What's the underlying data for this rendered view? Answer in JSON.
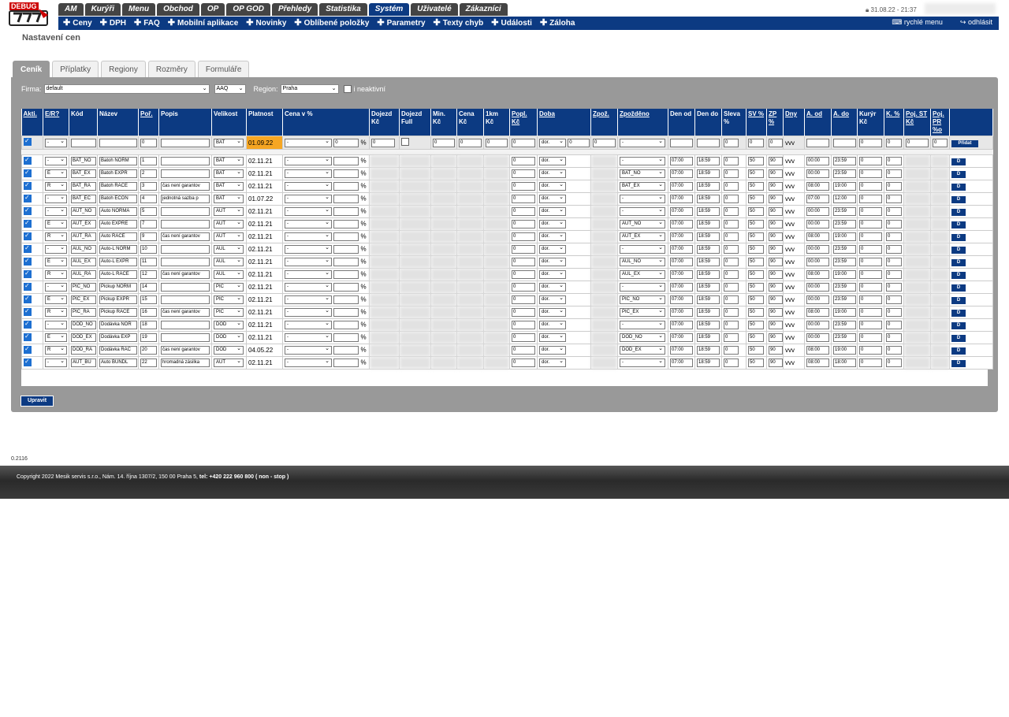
{
  "header": {
    "debug_label": "DEBUG",
    "tabs": [
      "AM",
      "Kurýři",
      "Menu",
      "Obchod",
      "OP",
      "OP GOD",
      "Přehledy",
      "Statistika",
      "Systém",
      "Uživatelé",
      "Zákazníci"
    ],
    "active_tab": "Systém",
    "submenu": [
      "Ceny",
      "DPH",
      "FAQ",
      "Mobilní aplikace",
      "Novinky",
      "Oblíbené položky",
      "Parametry",
      "Texty chyb",
      "Události",
      "Záloha"
    ],
    "quick_menu": "rychlé menu",
    "logout": "odhlásit",
    "clock": "31.08.22 - 21:37"
  },
  "page_title": "Nastavení cen",
  "page_tabs": [
    "Ceník",
    "Příplatky",
    "Regiony",
    "Rozměry",
    "Formuláře"
  ],
  "filters": {
    "firma_label": "Firma:",
    "firma_value": "default",
    "aaq_value": "AAQ",
    "region_label": "Region:",
    "region_value": "Praha",
    "inactive_label": "i neaktivní"
  },
  "table": {
    "headers": [
      "Akti.",
      "E/R?",
      "Kód",
      "Název",
      "Poř.",
      "Popis",
      "Velikost",
      "Platnost",
      "Cena v %",
      "Dojezd Kč",
      "Dojezd Full",
      "Min. Kč",
      "Cena Kč",
      "1km Kč",
      "Popl. Kč",
      "Doba",
      "Zpož.",
      "Zpožděno",
      "Den od",
      "Den do",
      "Sleva %",
      "SV %",
      "ZP %",
      "Dny",
      "A. od",
      "A. do",
      "Kurýr Kč",
      "K. %",
      "Poj. ST Kč",
      "Poj. PR %o",
      ""
    ],
    "new_row": {
      "er": "-",
      "poradi": "0",
      "velikost": "BAT",
      "platnost": "01.09.22",
      "cena": "-",
      "cena_pct": "0",
      "pct": "%",
      "dojezd": "0",
      "min": "0",
      "cena_kc": "0",
      "km": "0",
      "popl": "0",
      "doba": "dor.",
      "doba_val": "0",
      "zpoz": "0",
      "zpozdeno": "-",
      "sleva": "0",
      "sv": "0",
      "zp": "0",
      "dny": "vvv",
      "kuryr": "0",
      "k": "0",
      "poj_st": "0",
      "poj_pr": "0",
      "button": "Přidat"
    },
    "rows": [
      {
        "er": "-",
        "kod": "BAT_NO",
        "nazev": "Batoh NORM",
        "por": "1",
        "popis": "",
        "vel": "BAT",
        "plat": "02.11.21",
        "zpozdeno": "-",
        "aod": "00:00",
        "ado": "23:59"
      },
      {
        "er": "E",
        "kod": "BAT_EX",
        "nazev": "Batoh EXPR",
        "por": "2",
        "popis": "",
        "vel": "BAT",
        "plat": "02.11.21",
        "zpozdeno": "BAT_NO",
        "aod": "00:00",
        "ado": "23:59"
      },
      {
        "er": "R",
        "kod": "BAT_RA",
        "nazev": "Batoh RACE",
        "por": "3",
        "popis": "čas není garantov",
        "vel": "BAT",
        "plat": "02.11.21",
        "zpozdeno": "BAT_EX",
        "aod": "08:00",
        "ado": "19:00"
      },
      {
        "er": "-",
        "kod": "BAT_EC",
        "nazev": "Batoh ECON",
        "por": "4",
        "popis": "jednotná sazba p",
        "vel": "BAT",
        "plat": "01.07.22",
        "zpozdeno": "-",
        "aod": "07:00",
        "ado": "12:00"
      },
      {
        "er": "-",
        "kod": "AUT_NO",
        "nazev": "Auto NORMA",
        "por": "5",
        "popis": "",
        "vel": "AUT",
        "plat": "02.11.21",
        "zpozdeno": "-",
        "aod": "00:00",
        "ado": "23:59"
      },
      {
        "er": "E",
        "kod": "AUT_EX",
        "nazev": "Auto EXPRE",
        "por": "7",
        "popis": "",
        "vel": "AUT",
        "plat": "02.11.21",
        "zpozdeno": "AUT_NO",
        "aod": "00:00",
        "ado": "23:59"
      },
      {
        "er": "R",
        "kod": "AUT_RA",
        "nazev": "Auto RACE",
        "por": "9",
        "popis": "čas není garantov",
        "vel": "AUT",
        "plat": "02.11.21",
        "zpozdeno": "AUT_EX",
        "aod": "08:00",
        "ado": "19:00"
      },
      {
        "er": "-",
        "kod": "AUL_NO",
        "nazev": "Auto-L NORM",
        "por": "10",
        "popis": "",
        "vel": "AUL",
        "plat": "02.11.21",
        "zpozdeno": "-",
        "aod": "00:00",
        "ado": "23:59"
      },
      {
        "er": "E",
        "kod": "AUL_EX",
        "nazev": "Auto-L EXPR",
        "por": "11",
        "popis": "",
        "vel": "AUL",
        "plat": "02.11.21",
        "zpozdeno": "AUL_NO",
        "aod": "00:00",
        "ado": "23:59"
      },
      {
        "er": "R",
        "kod": "AUL_RA",
        "nazev": "Auto-L RACE",
        "por": "12",
        "popis": "čas není garantov",
        "vel": "AUL",
        "plat": "02.11.21",
        "zpozdeno": "AUL_EX",
        "aod": "08:00",
        "ado": "19:00"
      },
      {
        "er": "-",
        "kod": "PIC_NO",
        "nazev": "Pickup NORM",
        "por": "14",
        "popis": "",
        "vel": "PIC",
        "plat": "02.11.21",
        "zpozdeno": "-",
        "aod": "00:00",
        "ado": "23:59"
      },
      {
        "er": "E",
        "kod": "PIC_EX",
        "nazev": "Pickup EXPR",
        "por": "15",
        "popis": "",
        "vel": "PIC",
        "plat": "02.11.21",
        "zpozdeno": "PIC_NO",
        "aod": "00:00",
        "ado": "23:59"
      },
      {
        "er": "R",
        "kod": "PIC_RA",
        "nazev": "Pickup RACE",
        "por": "16",
        "popis": "čas není garantov",
        "vel": "PIC",
        "plat": "02.11.21",
        "zpozdeno": "PIC_EX",
        "aod": "08:00",
        "ado": "19:00"
      },
      {
        "er": "-",
        "kod": "DOD_NO",
        "nazev": "Dodávka NOR",
        "por": "18",
        "popis": "",
        "vel": "DOD",
        "plat": "02.11.21",
        "zpozdeno": "-",
        "aod": "00:00",
        "ado": "23:59"
      },
      {
        "er": "E",
        "kod": "DOD_EX",
        "nazev": "Dodávka EXP",
        "por": "19",
        "popis": "",
        "vel": "DOD",
        "plat": "02.11.21",
        "zpozdeno": "DOD_NO",
        "aod": "00:00",
        "ado": "23:59"
      },
      {
        "er": "R",
        "kod": "DOD_RA",
        "nazev": "Dodávka RAC",
        "por": "20",
        "popis": "čas není garantov",
        "vel": "DOD",
        "plat": "04.05.22",
        "zpozdeno": "DOD_EX",
        "aod": "08:00",
        "ado": "19:00"
      },
      {
        "er": "-",
        "kod": "AUT_BU",
        "nazev": "Auto BUNDL",
        "por": "22",
        "popis": "hromadná zásilka",
        "vel": "AUT",
        "plat": "02.11.21",
        "zpozdeno": "-",
        "aod": "08:00",
        "ado": "18:00"
      }
    ],
    "row_common": {
      "cena": "-",
      "pct": "%",
      "popl": "0",
      "doba": "dor.",
      "den_od": "07:00",
      "den_do": "18:59",
      "sleva": "0",
      "sv": "50",
      "zp": "90",
      "dny": "vvv",
      "kuryr": "0",
      "k": "0",
      "button": "D"
    }
  },
  "save_button": "Upravit",
  "version": "0.2116",
  "footer": {
    "text": "Copyright 2022 Mesik servis s.r.o., Nám. 14. října 1307/2, 150 00 Praha 5,",
    "phone": "tel: +420 222 960 800 ( non - stop )"
  }
}
